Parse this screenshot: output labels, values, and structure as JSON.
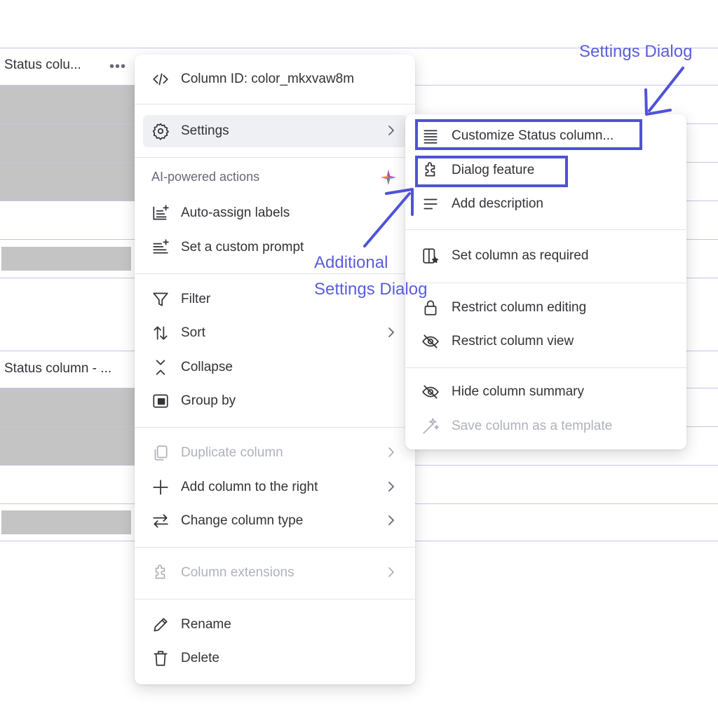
{
  "table": {
    "col1_header": "Status colu...",
    "col2_header": "Status column - ...",
    "more_label": "•••"
  },
  "menu": {
    "column_id": "Column ID: color_mkxvaw8m",
    "settings": "Settings",
    "ai_section": "AI-powered actions",
    "auto_assign": "Auto-assign labels",
    "custom_prompt": "Set a custom prompt",
    "filter": "Filter",
    "sort": "Sort",
    "collapse": "Collapse",
    "group_by": "Group by",
    "duplicate": "Duplicate column",
    "add_right": "Add column to the right",
    "change_type": "Change column type",
    "extensions": "Column extensions",
    "rename": "Rename",
    "delete": "Delete"
  },
  "submenu": {
    "customize": "Customize Status column...",
    "dialog_feature": "Dialog feature",
    "add_description": "Add description",
    "set_required": "Set column as required",
    "restrict_editing": "Restrict column editing",
    "restrict_view": "Restrict column view",
    "hide_summary": "Hide column summary",
    "save_template": "Save column as a template"
  },
  "annotations": {
    "settings_dialog": "Settings Dialog",
    "additional_line1": "Additional",
    "additional_line2": "Settings Dialog"
  },
  "colors": {
    "annotation": "#4f52d8",
    "ai_sparkle": "#e24c8a",
    "active_bg": "#eff0f3"
  }
}
